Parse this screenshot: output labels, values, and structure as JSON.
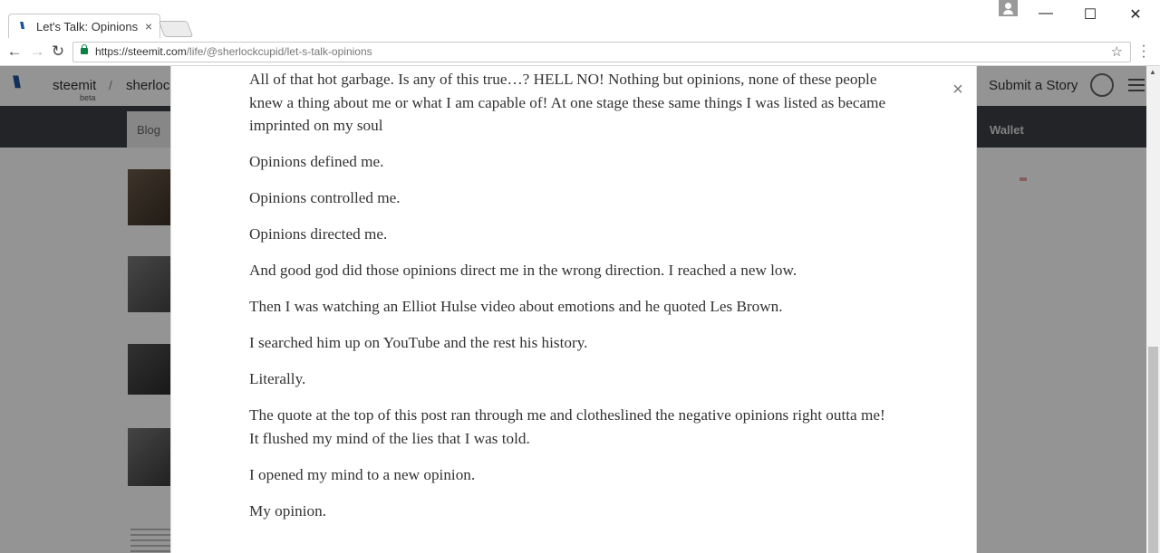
{
  "browser": {
    "tab_title": "Let's Talk: Opinions",
    "tab_close": "×",
    "url_host": "https://steemit.com",
    "url_path": "/life/@sherlockcupid/let-s-talk-opinions",
    "window_minimize": "—",
    "window_maximize": "☐",
    "window_close": "✕",
    "back_icon": "←",
    "forward_icon": "→",
    "reload_icon": "↻",
    "star_icon": "☆",
    "menu_icon": "⋮"
  },
  "site": {
    "brand": "steemit",
    "brand_sub": "beta",
    "crumb": "sherlock",
    "submit_label": "Submit a Story",
    "subnav_blog": "Blog",
    "subnav_wallet": "Wallet"
  },
  "modal": {
    "close_label": "×",
    "paragraphs": [
      "All of that hot garbage. Is any of this true…? HELL NO! Nothing but opinions, none of these people knew a thing about me or what I am capable of! At one stage these same things I was listed as became imprinted on my soul",
      "Opinions defined me.",
      "Opinions controlled me.",
      "Opinions directed me.",
      "And good god did those opinions direct me in the wrong direction. I reached a new low.",
      "Then I was watching an Elliot Hulse video about emotions and he quoted Les Brown.",
      "I searched him up on YouTube and the rest his history.",
      "Literally.",
      "The quote at the top of this post ran through me and clotheslined the negative opinions right outta me!",
      "It flushed my mind of the lies that I was told.",
      "I opened my mind to a new opinion.",
      "My opinion."
    ]
  }
}
